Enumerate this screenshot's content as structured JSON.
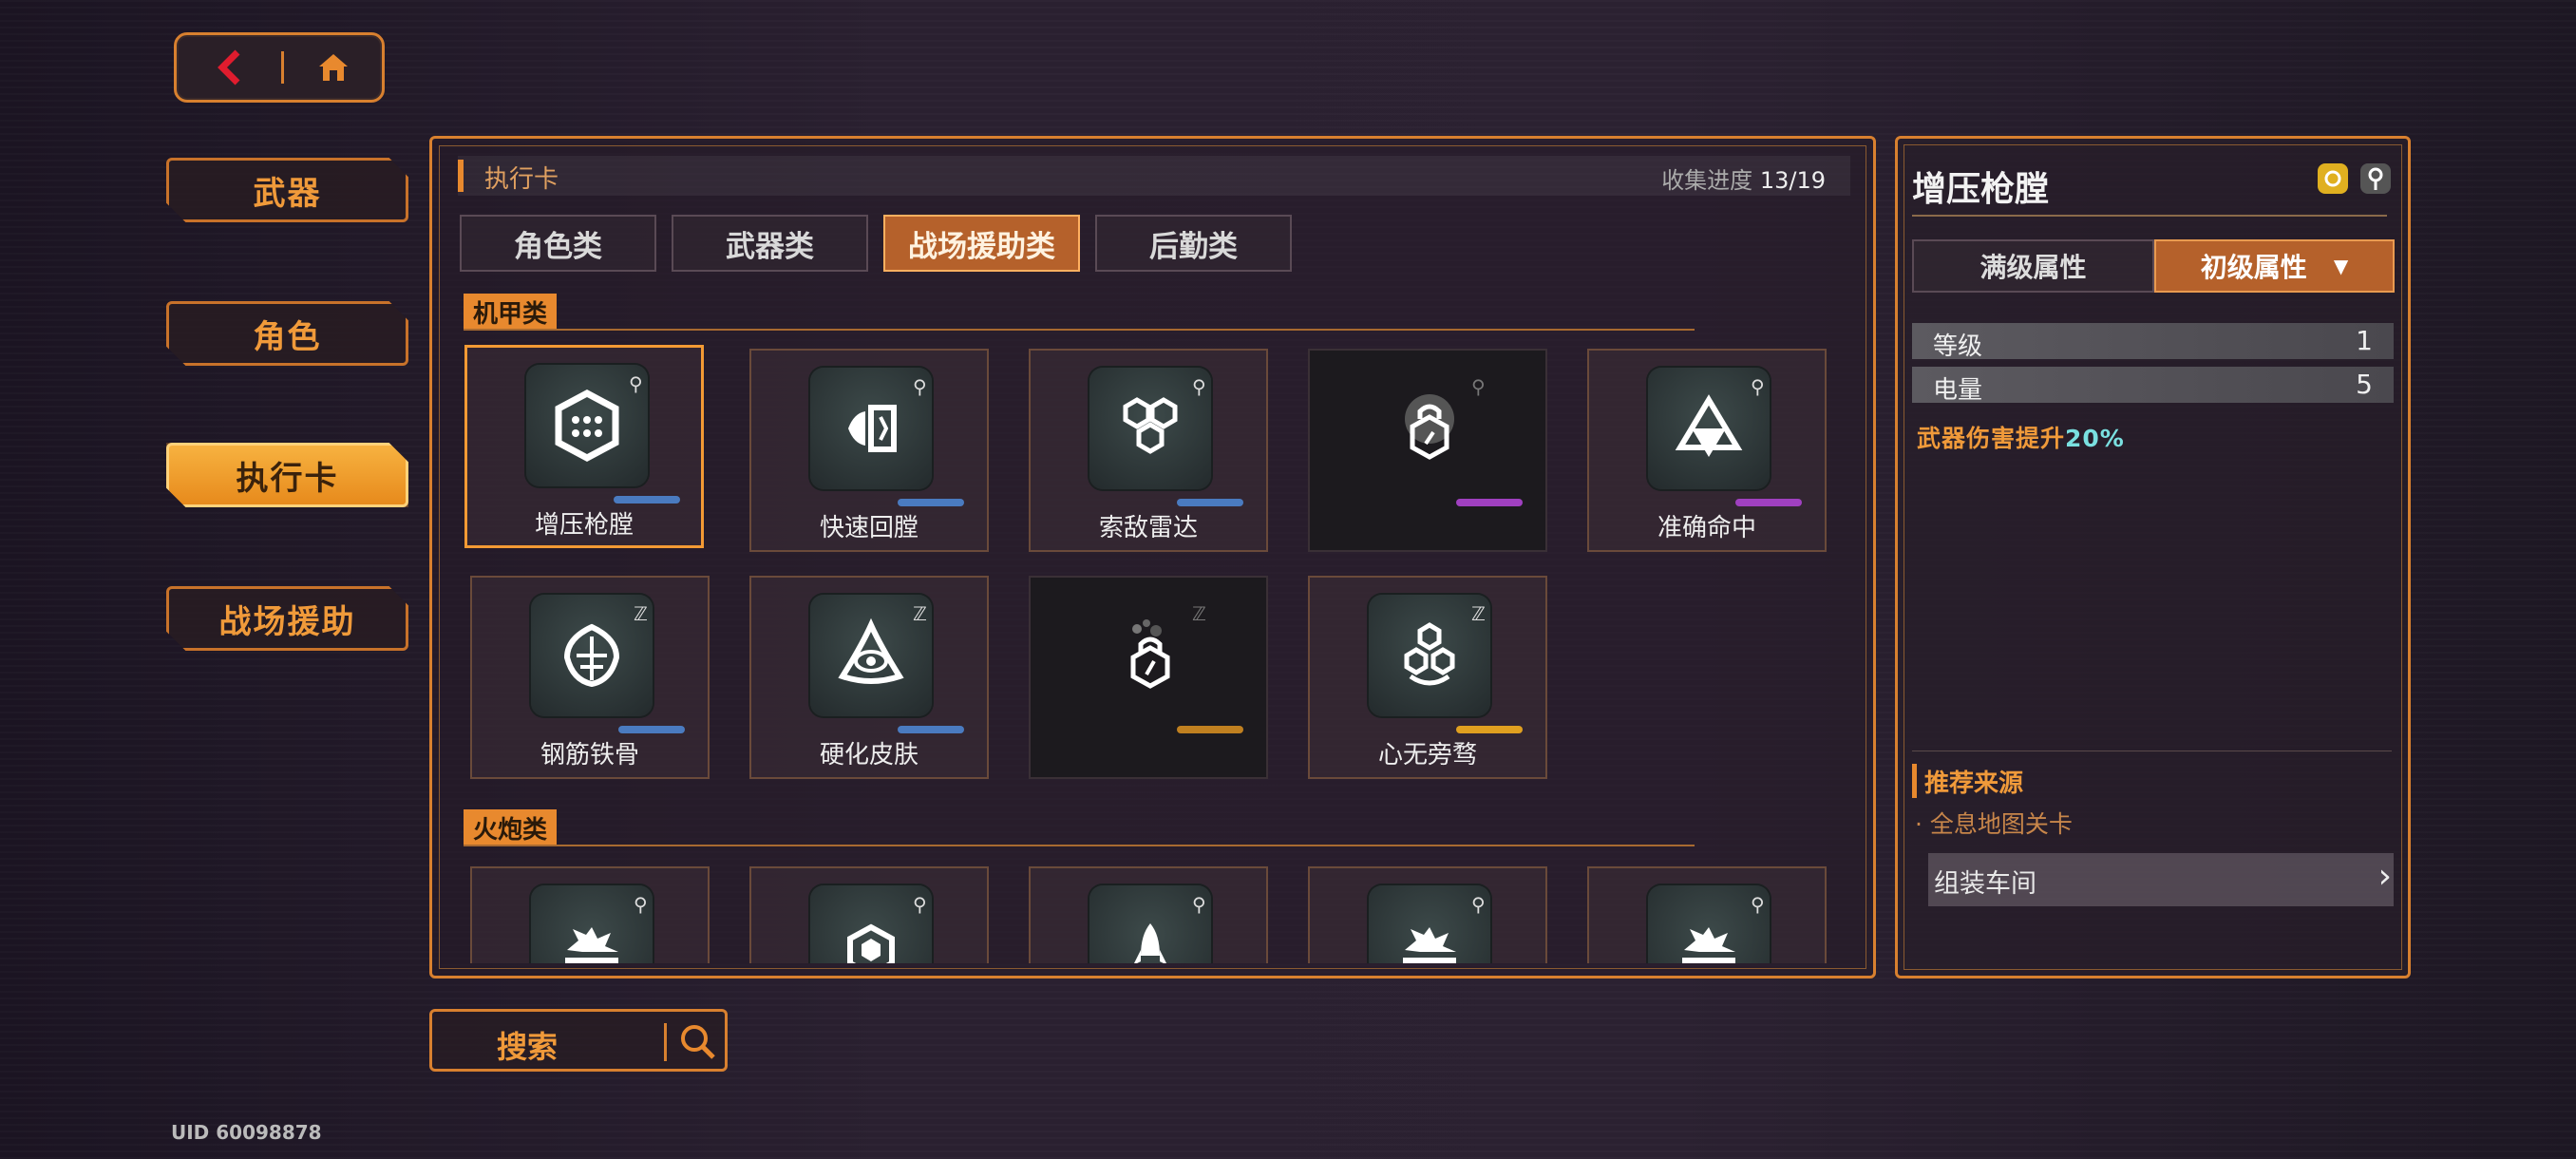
{
  "topnav": {
    "back_icon": "back-arrow-icon",
    "home_icon": "home-icon"
  },
  "side_menu": [
    {
      "label": "武器",
      "active": false
    },
    {
      "label": "角色",
      "active": false
    },
    {
      "label": "执行卡",
      "active": true
    },
    {
      "label": "战场援助",
      "active": false
    }
  ],
  "panel": {
    "title": "执行卡",
    "progress_label": "收集进度 ",
    "progress_value": "13/19"
  },
  "tabs": [
    {
      "label": "角色类",
      "active": false
    },
    {
      "label": "武器类",
      "active": false
    },
    {
      "label": "战场援助类",
      "active": true
    },
    {
      "label": "后勤类",
      "active": false
    }
  ],
  "sections": {
    "mech": "机甲类",
    "artillery": "火炮类"
  },
  "cards": [
    {
      "label": "增压枪膛",
      "bar_color": "#4a7bc0",
      "badge": "pin",
      "selected": true,
      "locked": false
    },
    {
      "label": "快速回膛",
      "bar_color": "#4a7bc0",
      "badge": "pin",
      "selected": false,
      "locked": false
    },
    {
      "label": "索敌雷达",
      "bar_color": "#4a7bc0",
      "badge": "pin",
      "selected": false,
      "locked": false
    },
    {
      "label": "",
      "bar_color": "#a040c0",
      "badge": "pin",
      "selected": false,
      "locked": true
    },
    {
      "label": "准确命中",
      "bar_color": "#a040c0",
      "badge": "pin",
      "selected": false,
      "locked": false
    },
    {
      "label": "钢筋铁骨",
      "bar_color": "#4a7bc0",
      "badge": "Z",
      "selected": false,
      "locked": false
    },
    {
      "label": "硬化皮肤",
      "bar_color": "#4a7bc0",
      "badge": "Z",
      "selected": false,
      "locked": false
    },
    {
      "label": "",
      "bar_color": "#c08020",
      "badge": "Z",
      "selected": false,
      "locked": true
    },
    {
      "label": "心无旁骛",
      "bar_color": "#e0a020",
      "badge": "Z",
      "selected": false,
      "locked": false
    }
  ],
  "search": {
    "label": "搜索"
  },
  "uid": "UID 60098878",
  "detail": {
    "title": "增压枪膛",
    "btn_max": "满级属性",
    "btn_init": "初级属性",
    "stats": [
      {
        "key": "等级",
        "value": "1"
      },
      {
        "key": "电量",
        "value": "5"
      }
    ],
    "effect_text": "武器伤害提升",
    "effect_value": "20%",
    "rec_title": "推荐来源",
    "rec_sub": "· 全息地图关卡",
    "rec_btn": "组装车间"
  },
  "colors": {
    "accent": "#e8892e",
    "active_tab": "#b5612b",
    "effect_value": "#7ae0e0"
  }
}
